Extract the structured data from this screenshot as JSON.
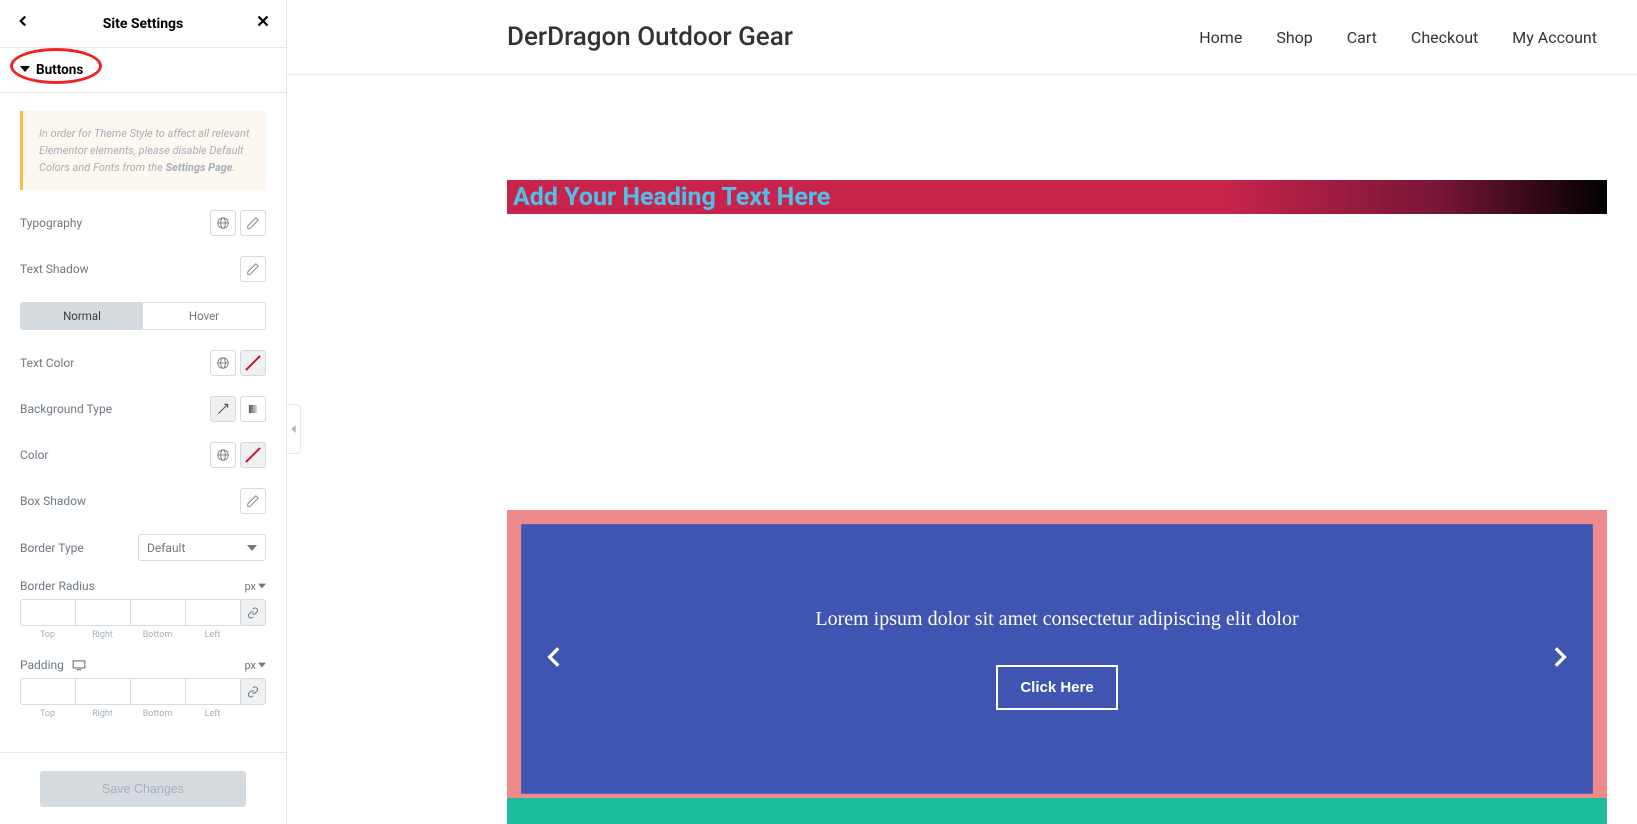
{
  "sidebar": {
    "title": "Site Settings",
    "accordion_label": "Buttons",
    "notice_text": "In order for Theme Style to affect all relevant Elementor elements, please disable Default Colors and Fonts from the ",
    "notice_link": "Settings Page",
    "controls": {
      "typography": "Typography",
      "text_shadow": "Text Shadow",
      "tab_normal": "Normal",
      "tab_hover": "Hover",
      "text_color": "Text Color",
      "bg_type": "Background Type",
      "color": "Color",
      "box_shadow": "Box Shadow",
      "border_type": "Border Type",
      "border_type_value": "Default",
      "border_radius": "Border Radius",
      "padding": "Padding",
      "unit": "px",
      "dim_top": "Top",
      "dim_right": "Right",
      "dim_bottom": "Bottom",
      "dim_left": "Left"
    },
    "save_label": "Save Changes"
  },
  "preview": {
    "site_title": "DerDragon Outdoor Gear",
    "nav": [
      "Home",
      "Shop",
      "Cart",
      "Checkout",
      "My Account"
    ],
    "heading_placeholder": "Add Your Heading Text Here",
    "slide_text": "Lorem ipsum dolor sit amet consectetur adipiscing elit dolor",
    "slide_button": "Click Here"
  }
}
